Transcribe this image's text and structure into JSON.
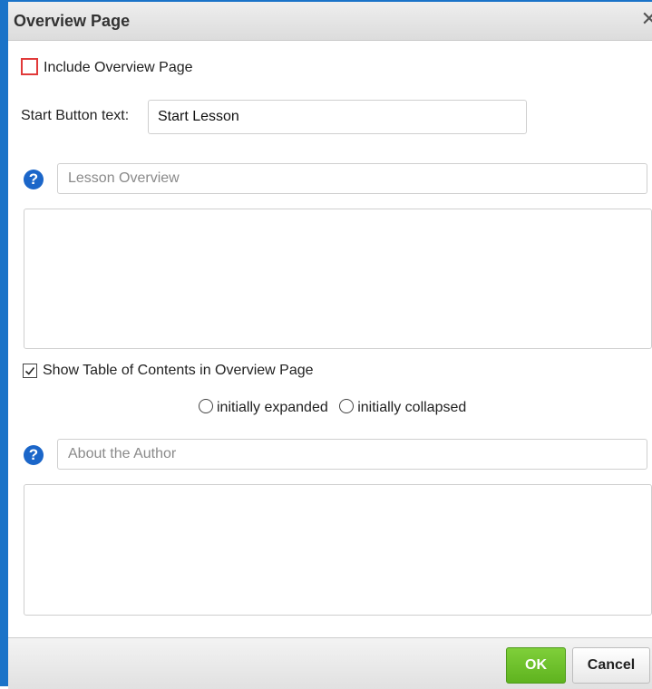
{
  "dialog": {
    "title": "Overview Page",
    "close_glyph": "✕"
  },
  "include_overview": {
    "label": "Include Overview Page",
    "checked": false
  },
  "start_button": {
    "label": "Start Button text:",
    "value": "Start Lesson"
  },
  "lesson_overview": {
    "title_placeholder": "Lesson Overview",
    "help_glyph": "?",
    "body": ""
  },
  "toc": {
    "label": "Show Table of Contents in Overview Page",
    "checked": true,
    "options": [
      {
        "label": "initially expanded",
        "selected": false
      },
      {
        "label": "initially collapsed",
        "selected": false
      }
    ]
  },
  "about_author": {
    "title_placeholder": "About the Author",
    "help_glyph": "?",
    "body": ""
  },
  "footer": {
    "ok_label": "OK",
    "cancel_label": "Cancel"
  },
  "colors": {
    "accent_border": "#1a73c8",
    "help_icon": "#1b66c9",
    "ok_button": "#6cbf2a",
    "highlight_checkbox": "#e13a3a"
  }
}
